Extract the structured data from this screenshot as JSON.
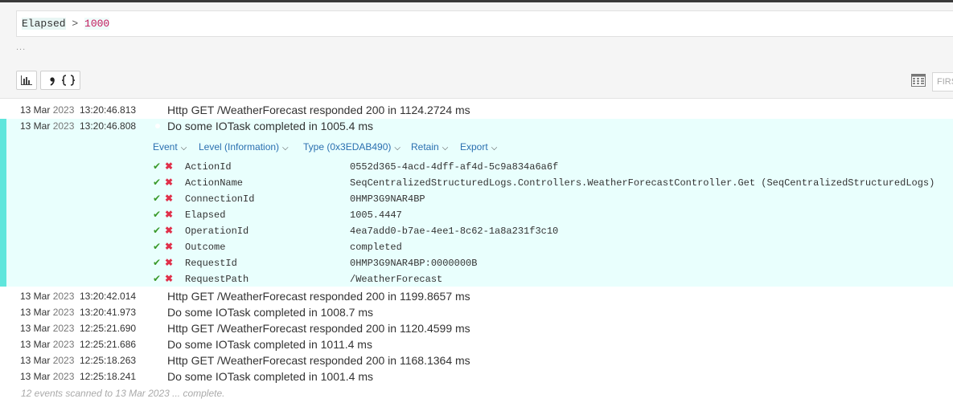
{
  "search": {
    "query_property": "Elapsed",
    "query_operator": " > ",
    "query_value": "1000",
    "ellipsis": "..."
  },
  "toolbar": {
    "first_label": "FIRS"
  },
  "events": [
    {
      "date": "13 Mar",
      "year": "2023",
      "time": "13:20:46.813",
      "message": "Http GET /WeatherForecast responded 200 in 1124.2724 ms"
    },
    {
      "date": "13 Mar",
      "year": "2023",
      "time": "13:20:46.808",
      "message": "Do some IOTask completed in 1005.4 ms"
    },
    {
      "date": "13 Mar",
      "year": "2023",
      "time": "13:20:42.014",
      "message": "Http GET /WeatherForecast responded 200 in 1199.8657 ms"
    },
    {
      "date": "13 Mar",
      "year": "2023",
      "time": "13:20:41.973",
      "message": "Do some IOTask completed in 1008.7 ms"
    },
    {
      "date": "13 Mar",
      "year": "2023",
      "time": "12:25:21.690",
      "message": "Http GET /WeatherForecast responded 200 in 1120.4599 ms"
    },
    {
      "date": "13 Mar",
      "year": "2023",
      "time": "12:25:21.686",
      "message": "Do some IOTask completed in 1011.4 ms"
    },
    {
      "date": "13 Mar",
      "year": "2023",
      "time": "12:25:18.263",
      "message": "Http GET /WeatherForecast responded 200 in 1168.1364 ms"
    },
    {
      "date": "13 Mar",
      "year": "2023",
      "time": "12:25:18.241",
      "message": "Do some IOTask completed in 1001.4 ms"
    }
  ],
  "expanded": {
    "menu": [
      "Event",
      "Level (Information)",
      "Type (0x3EDAB490)",
      "Retain",
      "Export"
    ],
    "properties": [
      {
        "name": "ActionId",
        "value": "0552d365-4acd-4dff-af4d-5c9a834a6a6f"
      },
      {
        "name": "ActionName",
        "value": "SeqCentralizedStructuredLogs.Controllers.WeatherForecastController.Get (SeqCentralizedStructuredLogs)"
      },
      {
        "name": "ConnectionId",
        "value": "0HMP3G9NAR4BP"
      },
      {
        "name": "Elapsed",
        "value": "1005.4447"
      },
      {
        "name": "OperationId",
        "value": "4ea7add0-b7ae-4ee1-8c62-1a8a231f3c10"
      },
      {
        "name": "Outcome",
        "value": "completed"
      },
      {
        "name": "RequestId",
        "value": "0HMP3G9NAR4BP:0000000B"
      },
      {
        "name": "RequestPath",
        "value": "/WeatherForecast"
      }
    ]
  },
  "footer": {
    "status": "12 events scanned to 13 Mar 2023 ... complete."
  },
  "colors": {
    "accent_bar": "#5fe6dc",
    "expanded_bg": "#e9fffd",
    "link": "#2a6fb0",
    "check": "#3a9a2b",
    "cross": "#e0304a"
  }
}
